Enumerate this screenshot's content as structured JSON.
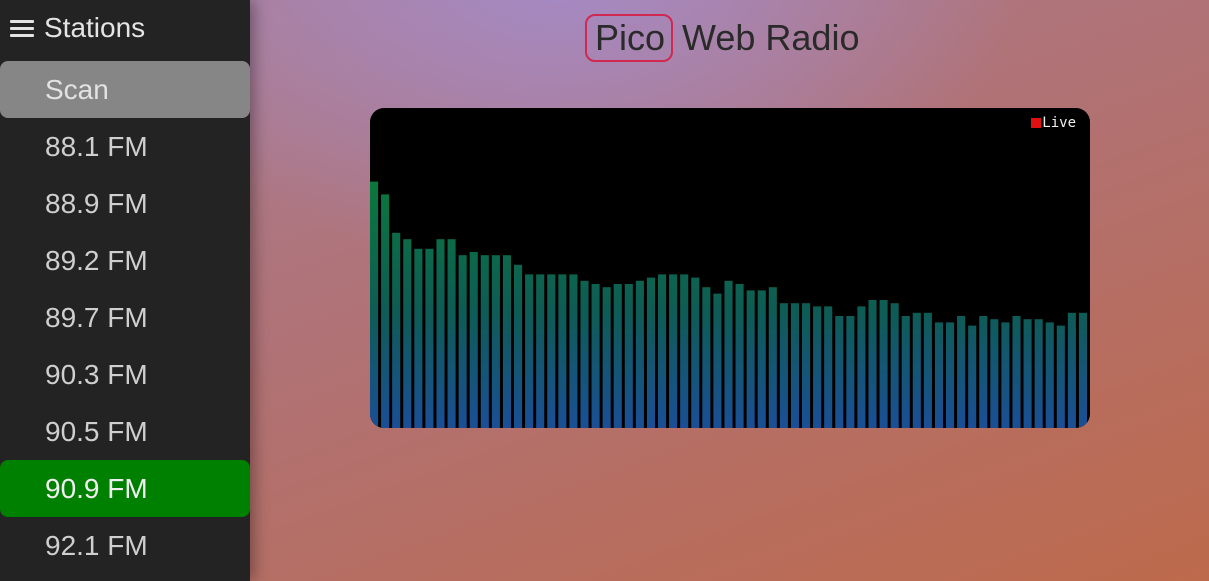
{
  "sidebar": {
    "title": "Stations",
    "menu_icon": "hamburger-menu-icon",
    "items": [
      {
        "label": "Scan",
        "state": "scan"
      },
      {
        "label": "88.1 FM",
        "state": "normal"
      },
      {
        "label": "88.9 FM",
        "state": "normal"
      },
      {
        "label": "89.2 FM",
        "state": "normal"
      },
      {
        "label": "89.7 FM",
        "state": "normal"
      },
      {
        "label": "90.3 FM",
        "state": "normal"
      },
      {
        "label": "90.5 FM",
        "state": "normal"
      },
      {
        "label": "90.9 FM",
        "state": "active"
      },
      {
        "label": "92.1 FM",
        "state": "normal"
      }
    ]
  },
  "header": {
    "title_boxed": "Pico",
    "title_rest": "Web Radio"
  },
  "visualizer": {
    "live_label": "Live",
    "live_color": "#e01010",
    "bar_color_top": "#0a7a3a",
    "bar_color_bottom": "#1a4f96",
    "levels": [
      0.77,
      0.73,
      0.61,
      0.59,
      0.56,
      0.56,
      0.59,
      0.59,
      0.54,
      0.55,
      0.54,
      0.54,
      0.54,
      0.51,
      0.48,
      0.48,
      0.48,
      0.48,
      0.48,
      0.46,
      0.45,
      0.44,
      0.45,
      0.45,
      0.46,
      0.47,
      0.48,
      0.48,
      0.48,
      0.47,
      0.44,
      0.42,
      0.46,
      0.45,
      0.43,
      0.43,
      0.44,
      0.39,
      0.39,
      0.39,
      0.38,
      0.38,
      0.35,
      0.35,
      0.38,
      0.4,
      0.4,
      0.39,
      0.35,
      0.36,
      0.36,
      0.33,
      0.33,
      0.35,
      0.32,
      0.35,
      0.34,
      0.33,
      0.35,
      0.34,
      0.34,
      0.33,
      0.32,
      0.36,
      0.36
    ]
  }
}
